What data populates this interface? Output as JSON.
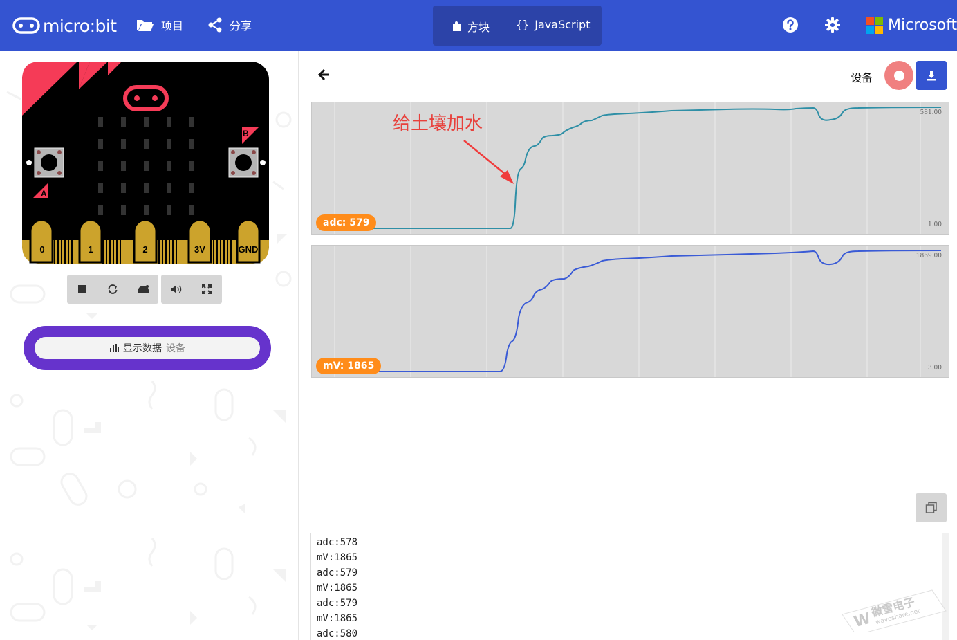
{
  "header": {
    "logo_text": "micro:bit",
    "projects_label": "项目",
    "share_label": "分享",
    "blocks_label": "方块",
    "javascript_label": "JavaScript",
    "microsoft_label": "Microsoft",
    "colors": {
      "bar": "#3454d1",
      "mode_group": "#2c43a8"
    }
  },
  "simulator": {
    "pins": [
      "0",
      "1",
      "2",
      "3V",
      "GND"
    ],
    "button_a": "A",
    "button_b": "B",
    "show_data_label": "显示数据",
    "show_data_device": "设备",
    "controls": [
      "stop-icon",
      "restart-icon",
      "slow-motion-icon",
      "sound-icon",
      "fullscreen-icon"
    ]
  },
  "serial": {
    "device_label": "设备",
    "annotation": "给土壤加水",
    "charts": [
      {
        "badge": "adc: 579",
        "max_label": "581.00",
        "min_label": "1.00",
        "color": "#2e8fa6"
      },
      {
        "badge": "mV: 1865",
        "max_label": "1869.00",
        "min_label": "3.00",
        "color": "#3a5bd6"
      }
    ],
    "console_lines": [
      "adc:578",
      "mV:1865",
      "adc:579",
      "mV:1865",
      "adc:579",
      "mV:1865",
      "adc:580"
    ],
    "watermark_text": "微雪电子",
    "watermark_sub": "waveshare.net"
  }
}
